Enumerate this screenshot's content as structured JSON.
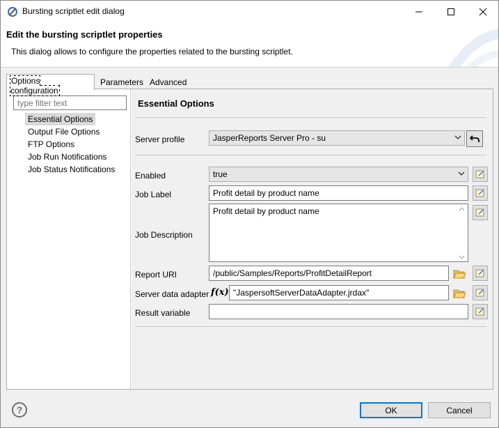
{
  "window": {
    "title": "Bursting scriptlet edit dialog"
  },
  "header": {
    "title": "Edit the bursting scriptlet properties",
    "description": "This dialog allows to configure the properties related to the bursting scriptlet."
  },
  "tabs": [
    {
      "label": "Options configuration",
      "active": true
    },
    {
      "label": "Parameters",
      "active": false
    },
    {
      "label": "Advanced",
      "active": false
    }
  ],
  "tree": {
    "filter_placeholder": "type filter text",
    "items": [
      {
        "label": "Essential Options",
        "selected": true
      },
      {
        "label": "Output File Options",
        "selected": false
      },
      {
        "label": "FTP Options",
        "selected": false
      },
      {
        "label": "Job Run Notifications",
        "selected": false
      },
      {
        "label": "Job Status Notifications",
        "selected": false
      }
    ]
  },
  "section": {
    "title": "Essential Options"
  },
  "form": {
    "server_profile": {
      "label": "Server profile",
      "value": "JasperReports Server Pro - su"
    },
    "enabled": {
      "label": "Enabled",
      "value": "true"
    },
    "job_label": {
      "label": "Job Label",
      "value": "Profit detail by product name"
    },
    "job_description": {
      "label": "Job Description",
      "value": "Profit detail by product name"
    },
    "report_uri": {
      "label": "Report URI",
      "value": "/public/Samples/Reports/ProfitDetailReport"
    },
    "server_data_adapter": {
      "label": "Server data adapter",
      "fx": "f(x)",
      "value": "\"JaspersoftServerDataAdapter.jrdax\""
    },
    "result_variable": {
      "label": "Result variable",
      "value": ""
    }
  },
  "footer": {
    "help": "?",
    "ok": "OK",
    "cancel": "Cancel"
  },
  "colors": {
    "accent": "#0078d7",
    "selection": "#d9d9d9",
    "background": "#f0f0f0"
  },
  "icons": [
    "app-icon",
    "minimize-icon",
    "maximize-icon",
    "close-icon",
    "undo-icon",
    "folder-icon",
    "note-edit-icon",
    "help-icon",
    "chevron-down-icon"
  ]
}
